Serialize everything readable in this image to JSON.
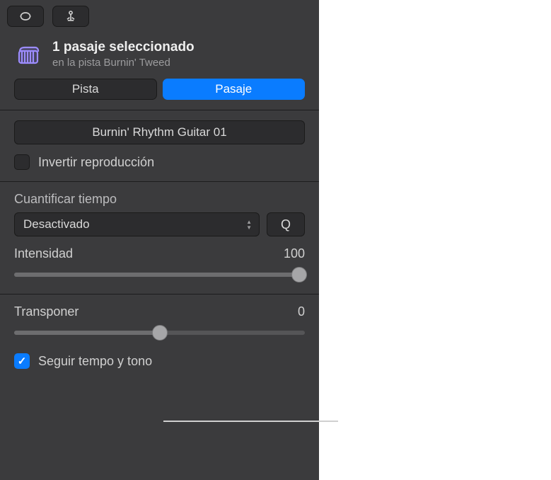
{
  "header": {
    "title": "1 pasaje seleccionado",
    "subtitle": "en la pista Burnin' Tweed"
  },
  "segments": {
    "pista": "Pista",
    "pasaje": "Pasaje"
  },
  "region": {
    "name": "Burnin' Rhythm Guitar 01",
    "invert_label": "Invertir reproducción"
  },
  "quantize": {
    "label": "Cuantificar tiempo",
    "value": "Desactivado",
    "q_button": "Q",
    "intensity_label": "Intensidad",
    "intensity_value": "100"
  },
  "transpose": {
    "label": "Transponer",
    "value": "0",
    "follow_label": "Seguir tempo y tono"
  }
}
